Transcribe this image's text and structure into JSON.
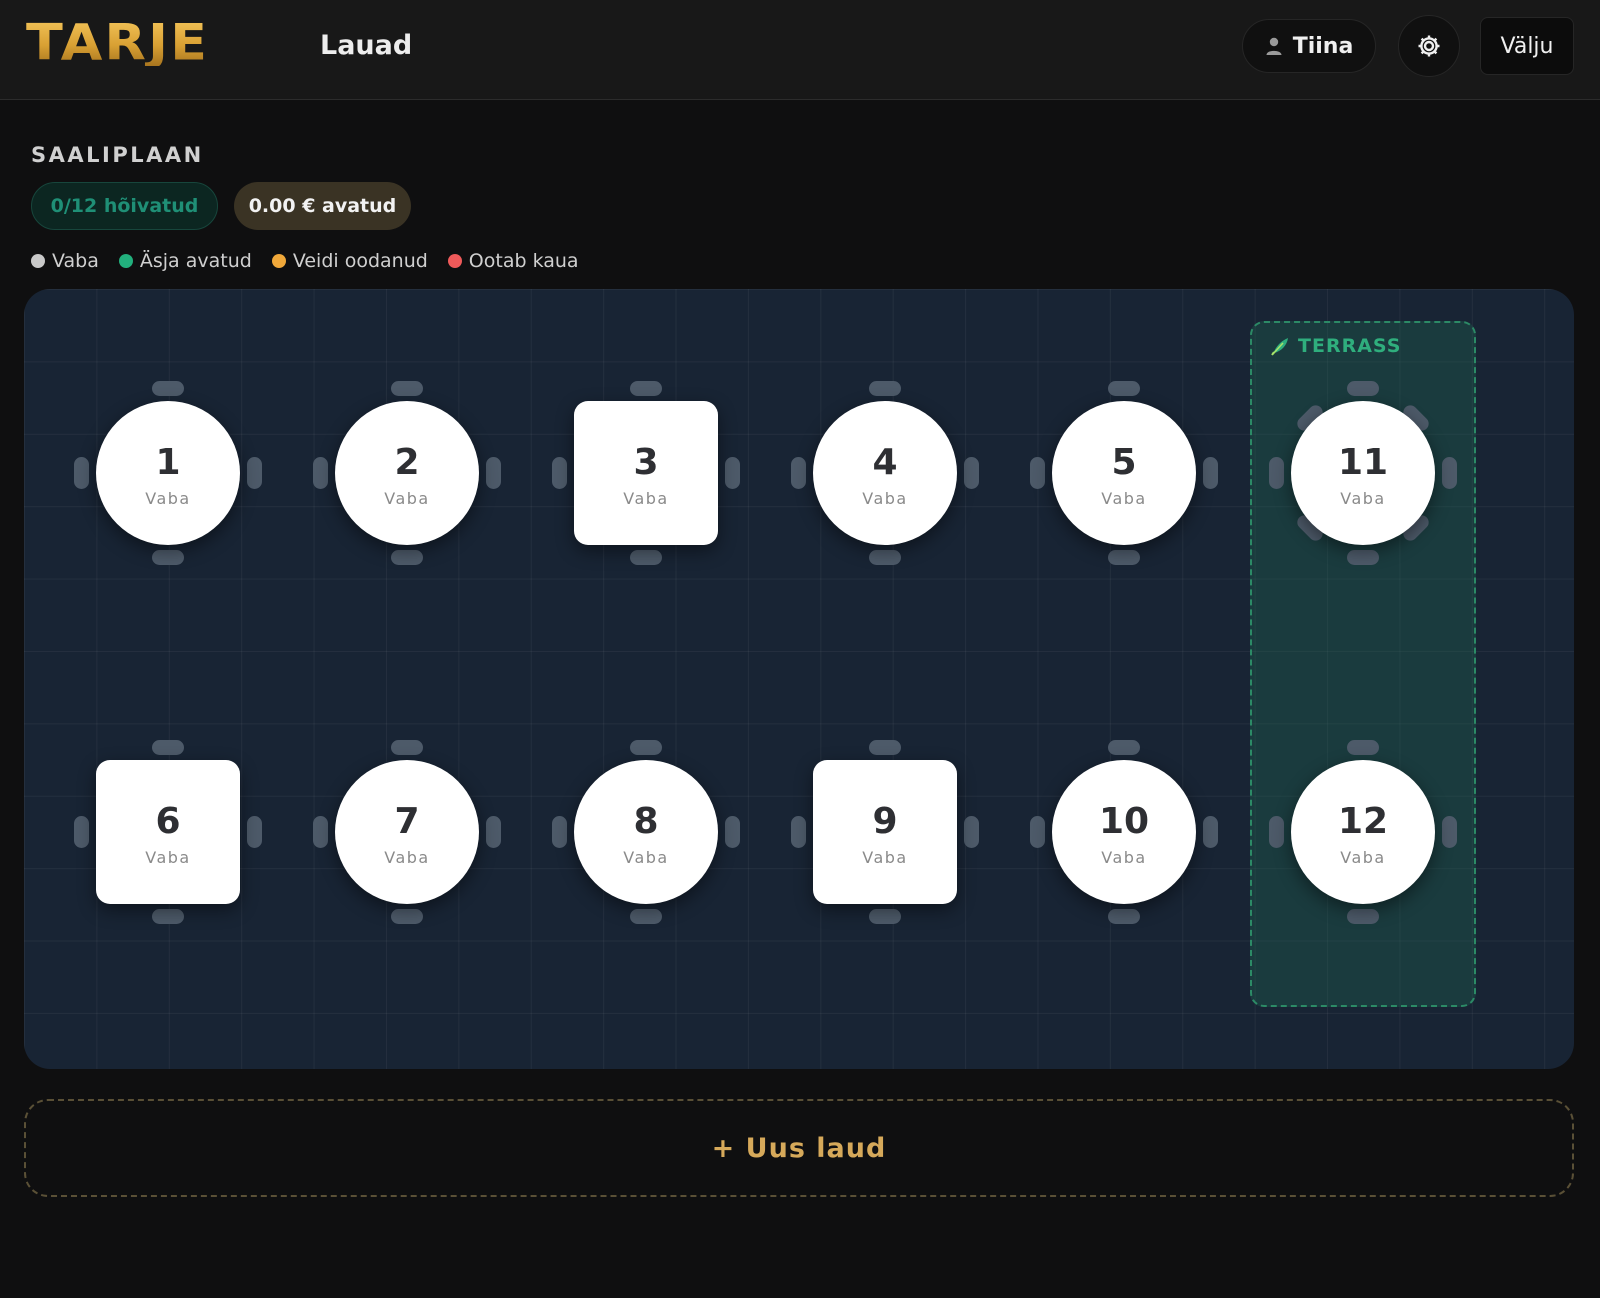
{
  "header": {
    "logo": "TARJE",
    "title": "Lauad",
    "user_name": "Tiina",
    "exit_label": "Välju",
    "accent_color": "#d8a033"
  },
  "floor_plan": {
    "section_title": "SAALIPLAAN",
    "stat_occupied": "0/12 hõivatud",
    "stat_open": "0.00 € avatud",
    "legend": [
      {
        "label": "Vaba",
        "color": "#c9c9c9"
      },
      {
        "label": "Äsja avatud",
        "color": "#22b07d"
      },
      {
        "label": "Veidi oodanud",
        "color": "#f0a83a"
      },
      {
        "label": "Ootab kaua",
        "color": "#ef5a5a"
      }
    ],
    "zone_label": "TERRASS",
    "zone_color": "#2fae7d"
  },
  "tables": [
    {
      "number": "1",
      "status": "Vaba",
      "shape": "round"
    },
    {
      "number": "2",
      "status": "Vaba",
      "shape": "round"
    },
    {
      "number": "3",
      "status": "Vaba",
      "shape": "square"
    },
    {
      "number": "4",
      "status": "Vaba",
      "shape": "round"
    },
    {
      "number": "5",
      "status": "Vaba",
      "shape": "round"
    },
    {
      "number": "11",
      "status": "Vaba",
      "shape": "round"
    },
    {
      "number": "6",
      "status": "Vaba",
      "shape": "square"
    },
    {
      "number": "7",
      "status": "Vaba",
      "shape": "round"
    },
    {
      "number": "8",
      "status": "Vaba",
      "shape": "round"
    },
    {
      "number": "9",
      "status": "Vaba",
      "shape": "square"
    },
    {
      "number": "10",
      "status": "Vaba",
      "shape": "round"
    },
    {
      "number": "12",
      "status": "Vaba",
      "shape": "round"
    }
  ],
  "actions": {
    "new_table_label": "+ Uus laud"
  }
}
